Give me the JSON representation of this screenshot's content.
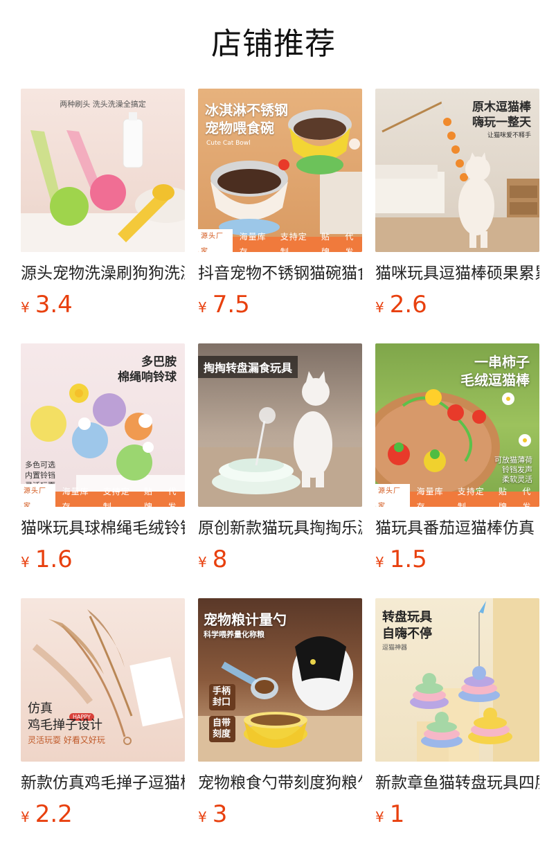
{
  "header": {
    "title": "店铺推荐"
  },
  "currency": "¥",
  "colors": {
    "price": "#e8400e",
    "title": "#111111",
    "name": "#222222"
  },
  "products": [
    {
      "name": "源头宠物洗澡刷狗狗洗澡刷",
      "price": "3.4",
      "image_text": {
        "top": "两种刷头 洗头洗澡全搞定"
      }
    },
    {
      "name": "抖音宠物不锈钢猫碗猫食盆",
      "price": "7.5",
      "image_text": {
        "head1": "冰淇淋不锈钢",
        "head2": "宠物喂食碗",
        "sub": "Cute Cat Bowl",
        "badge_source": "源头厂家",
        "badge": [
          "海量库存",
          "支持定制",
          "贴牌",
          "代发"
        ]
      }
    },
    {
      "name": "猫咪玩具逗猫棒硕果累累",
      "price": "2.6",
      "image_text": {
        "head1": "原木逗猫棒",
        "head2": "嗨玩一整天",
        "sub": "让猫咪爱不释手"
      }
    },
    {
      "name": "猫咪玩具球棉绳毛绒铃铛",
      "price": "1.6",
      "image_text": {
        "head1": "多巴胺",
        "head2": "棉绳响铃球",
        "side1": "多色可选",
        "side2": "内置铃铛",
        "side3": "灵活玩耍",
        "badge_source": "源头厂家",
        "badge": [
          "海量库存",
          "支持定制",
          "贴牌",
          "代发"
        ]
      }
    },
    {
      "name": "原创新款猫玩具掏掏乐漏食",
      "price": "8",
      "image_text": {
        "head1": "掏掏转盘漏食玩具"
      }
    },
    {
      "name": "猫玩具番茄逗猫棒仿真",
      "price": "1.5",
      "image_text": {
        "head1": "一串柿子",
        "head2": "毛绒逗猫棒",
        "side1": "可放猫薄荷",
        "side2": "铃铛发声",
        "side3": "柔软灵活",
        "badge_source": "源头厂家",
        "badge": [
          "海量库存",
          "支持定制",
          "贴牌",
          "代发"
        ]
      }
    },
    {
      "name": "新款仿真鸡毛掸子逗猫棒",
      "price": "2.2",
      "image_text": {
        "head1": "仿真",
        "head2": "鸡毛掸子设计",
        "sub": "灵活玩耍 好看又好玩",
        "tag": "HAPPY"
      }
    },
    {
      "name": "宠物粮食勺带刻度狗粮勺",
      "price": "3",
      "image_text": {
        "head1": "宠物粮计量勺",
        "sub": "科学喂养量化称粮",
        "tag1": "手柄封口",
        "tag2": "自带刻度"
      }
    },
    {
      "name": "新款章鱼猫转盘玩具四层",
      "price": "1",
      "image_text": {
        "head1": "转盘玩具",
        "head2": "自嗨不停",
        "sub": "逗猫神器"
      }
    }
  ]
}
